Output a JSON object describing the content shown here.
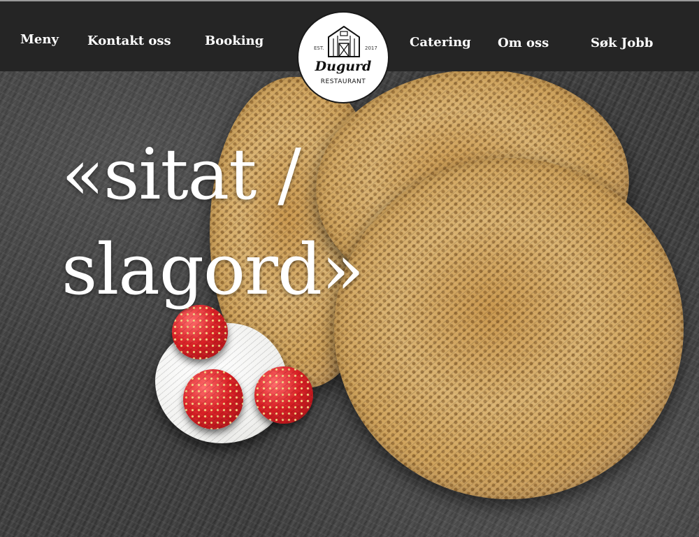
{
  "nav": {
    "items": [
      {
        "label": "Meny"
      },
      {
        "label": "Kontakt oss"
      },
      {
        "label": "Booking"
      },
      {
        "label": "Catering"
      },
      {
        "label": "Om oss"
      },
      {
        "label": "Søk Jobb"
      }
    ]
  },
  "logo": {
    "est": "EST.",
    "year": "2017",
    "name": "Dugurd",
    "subtitle": "RESTAURANT",
    "icon": "barn-icon"
  },
  "hero": {
    "headline_line1": "«sitat /",
    "headline_line2": "slagord»",
    "image_subject": "pancakes-with-strawberries-and-cream"
  },
  "colors": {
    "nav_background": "#252525",
    "nav_text": "#ffffff",
    "headline_text": "#ffffff",
    "logo_background": "#ffffff"
  }
}
